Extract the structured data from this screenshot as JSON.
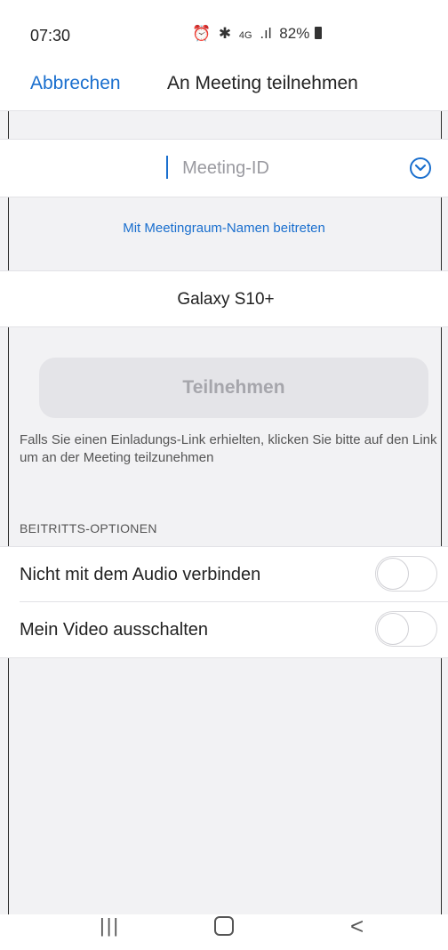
{
  "status_bar": {
    "time": "07:30",
    "icons": [
      "alarm-icon",
      "bluetooth-icon",
      "network-4g-icon",
      "signal-icon"
    ],
    "network_label": "4G",
    "battery_text": "82%"
  },
  "header": {
    "cancel_label": "Abbrechen",
    "title": "An Meeting teilnehmen"
  },
  "meeting_id": {
    "placeholder": "Meeting-ID",
    "value": ""
  },
  "room_link_label": "Mit Meetingraum-Namen beitreten",
  "display_name": "Galaxy S10+",
  "join_button_label": "Teilnehmen",
  "hint": "Falls Sie einen Einladungs-Link erhielten, klicken Sie bitte auf den Link um an der Meeting teilzunehmen",
  "options": {
    "section_title": "BEITRITTS-OPTIONEN",
    "items": [
      {
        "label": "Nicht mit dem Audio verbinden",
        "enabled": false
      },
      {
        "label": "Mein Video ausschalten",
        "enabled": false
      }
    ]
  },
  "nav": {
    "recents_glyph": "|||",
    "back_glyph": "<"
  },
  "colors": {
    "accent": "#1a6fce",
    "background": "#f2f2f4"
  }
}
